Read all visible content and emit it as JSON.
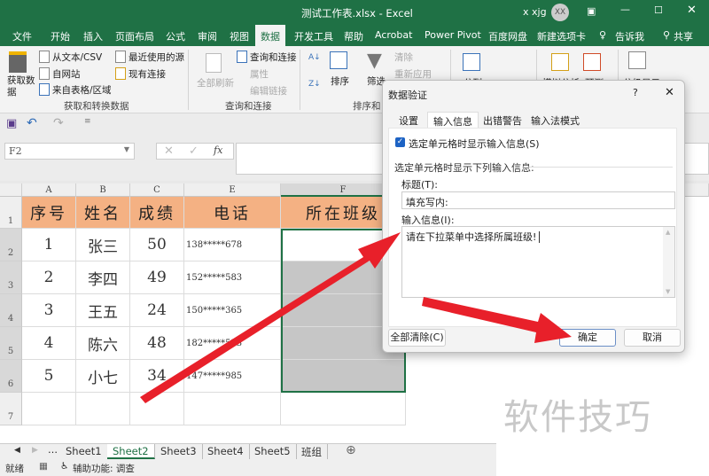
{
  "window": {
    "title": "测试工作表.xlsx  -  Excel",
    "user": "x xjg",
    "avatar": "XX"
  },
  "ribbon_tabs": [
    "文件",
    "开始",
    "插入",
    "页面布局",
    "公式",
    "审阅",
    "视图",
    "数据",
    "开发工具",
    "帮助",
    "Acrobat",
    "Power Pivot",
    "百度网盘",
    "新建选项卡",
    "告诉我",
    "共享"
  ],
  "active_tab": "数据",
  "ribbon": {
    "get_data": "获取数\n据",
    "from_text": "从文本/CSV",
    "from_web": "自网站",
    "from_table": "来自表格/区域",
    "recent": "最近使用的源",
    "existing": "现有连接",
    "group1": "获取和转换数据",
    "refresh_all": "全部刷新",
    "queries": "查询和连接",
    "properties": "属性",
    "edit_links": "编辑链接",
    "group2": "查询和连接",
    "sort": "排序",
    "filter": "筛选",
    "clear": "清除",
    "reapply": "重新应用",
    "group3": "排序和",
    "split": "分列",
    "whatif": "模拟分析",
    "forecast": "预测",
    "outline": "分级显示"
  },
  "formula_bar": {
    "name_box": "F2",
    "formula": ""
  },
  "columns": [
    "A",
    "B",
    "C",
    "E",
    "F"
  ],
  "rows": [
    "1",
    "2",
    "3",
    "4",
    "5",
    "6",
    "7"
  ],
  "table": {
    "headers": [
      "序号",
      "姓名",
      "成绩",
      "电话",
      "所在班级"
    ],
    "data": [
      [
        "1",
        "张三",
        "50",
        "138*****678",
        ""
      ],
      [
        "2",
        "李四",
        "49",
        "152*****583",
        ""
      ],
      [
        "3",
        "王五",
        "24",
        "150*****365",
        ""
      ],
      [
        "4",
        "陈六",
        "48",
        "182*****523",
        ""
      ],
      [
        "5",
        "小七",
        "34",
        "147*****985",
        ""
      ]
    ]
  },
  "sheets": [
    "Sheet1",
    "Sheet2",
    "Sheet3",
    "Sheet4",
    "Sheet5",
    "班组"
  ],
  "active_sheet": "Sheet2",
  "status": {
    "ready": "就绪",
    "accessibility": "辅助功能: 调查"
  },
  "dialog": {
    "title": "数据验证",
    "help": "?",
    "close": "✕",
    "tabs": [
      "设置",
      "输入信息",
      "出错警告",
      "输入法模式"
    ],
    "active_tab": "输入信息",
    "show_checkbox": "选定单元格时显示输入信息(S)",
    "show_checked": true,
    "section": "选定单元格时显示下列输入信息:",
    "title_label": "标题(T):",
    "title_value": "填充写内:",
    "msg_label": "输入信息(I):",
    "msg_value": "请在下拉菜单中选择所属班级!",
    "clear_all": "全部清除(C)",
    "ok": "确定",
    "cancel": "取消"
  },
  "watermark": "软件技巧",
  "colors": {
    "excel_green": "#1f7145",
    "header_fill": "#f4b183",
    "arrow": "#e8202a",
    "selection": "#c6c6c6"
  }
}
